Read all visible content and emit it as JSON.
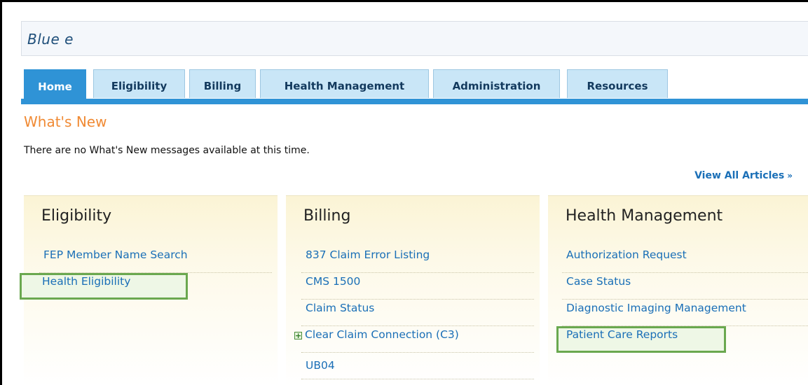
{
  "brand": {
    "title": "Blue e"
  },
  "tabs": [
    {
      "label": "Home",
      "active": true
    },
    {
      "label": "Eligibility"
    },
    {
      "label": "Billing"
    },
    {
      "label": "Health Management"
    },
    {
      "label": "Administration"
    },
    {
      "label": "Resources"
    }
  ],
  "whats_new": {
    "title": "What's New",
    "message": "There are no What's New messages available at this time.",
    "view_all": "View All Articles",
    "view_all_icon": "double-chevron-right-icon"
  },
  "panels": [
    {
      "title": "Eligibility",
      "links": [
        {
          "label": "FEP Member Name Search"
        },
        {
          "label": "Health Eligibility",
          "highlighted": true
        }
      ]
    },
    {
      "title": "Billing",
      "links": [
        {
          "label": "837 Claim Error Listing"
        },
        {
          "label": "CMS 1500"
        },
        {
          "label": "Claim Status"
        },
        {
          "label": "Clear Claim Connection (C3)",
          "icon": "expand-plus-icon"
        },
        {
          "label": "UB04"
        }
      ]
    },
    {
      "title": "Health Management",
      "links": [
        {
          "label": "Authorization Request"
        },
        {
          "label": "Case Status"
        },
        {
          "label": "Diagnostic Imaging Management"
        },
        {
          "label": "Patient Care Reports",
          "highlighted": true
        }
      ]
    }
  ],
  "colors": {
    "tab_active": "#2f93d6",
    "tab_inactive": "#c9e6f7",
    "link": "#1a6fb7",
    "whats_new_title": "#f08a34",
    "highlight_border": "#6aa84f"
  }
}
